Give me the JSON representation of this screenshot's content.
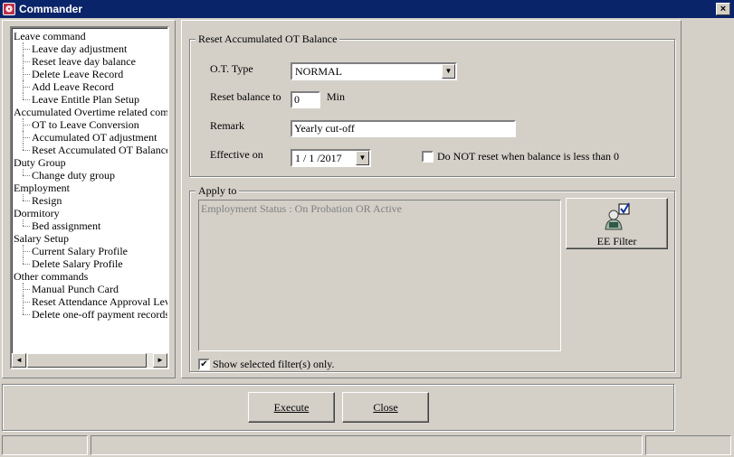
{
  "window": {
    "title": "Commander",
    "close_glyph": "×",
    "icon": "app-icon"
  },
  "tree": {
    "items": [
      {
        "label": "Leave command",
        "level": 0
      },
      {
        "label": "Leave day adjustment",
        "level": 1
      },
      {
        "label": "Reset leave day balance",
        "level": 1
      },
      {
        "label": "Delete Leave Record",
        "level": 1
      },
      {
        "label": "Add Leave Record",
        "level": 1
      },
      {
        "label": "Leave Entitle Plan Setup",
        "level": 1
      },
      {
        "label": "Accumulated Overtime related comm",
        "level": 0
      },
      {
        "label": "OT to Leave Conversion",
        "level": 1
      },
      {
        "label": "Accumulated OT adjustment",
        "level": 1
      },
      {
        "label": "Reset Accumulated OT Balance",
        "level": 1
      },
      {
        "label": "Duty Group",
        "level": 0
      },
      {
        "label": "Change duty group",
        "level": 1
      },
      {
        "label": "Employment",
        "level": 0
      },
      {
        "label": "Resign",
        "level": 1
      },
      {
        "label": "Dormitory",
        "level": 0
      },
      {
        "label": "Bed assignment",
        "level": 1
      },
      {
        "label": "Salary Setup",
        "level": 0
      },
      {
        "label": "Current Salary Profile",
        "level": 1
      },
      {
        "label": "Delete Salary Profile",
        "level": 1
      },
      {
        "label": "Other commands",
        "level": 0
      },
      {
        "label": "Manual Punch Card",
        "level": 1
      },
      {
        "label": "Reset Attendance Approval Leve",
        "level": 1
      },
      {
        "label": "Delete one-off payment records",
        "level": 1
      }
    ],
    "scroll_left": "◄",
    "scroll_right": "►"
  },
  "reset_group": {
    "title": "Reset Accumulated OT Balance",
    "ot_type_label": "O.T. Type",
    "ot_type_value": "NORMAL",
    "reset_balance_label": "Reset balance to",
    "reset_balance_value": "0",
    "unit": "Min",
    "remark_label": "Remark",
    "remark_value": "Yearly cut-off",
    "effective_label": "Effective on",
    "effective_value": "1 / 1 /2017",
    "no_reset_label": "Do NOT reset when balance is less than 0",
    "no_reset_checked": false,
    "drop_glyph": "▼"
  },
  "apply_group": {
    "title": "Apply to",
    "filter_text": "Employment Status : On Probation OR Active",
    "ee_filter_label": "EE Filter",
    "show_selected_label": "Show selected filter(s) only.",
    "show_selected_checked": true,
    "check_glyph": "✔"
  },
  "actions": {
    "execute_label": "Execute",
    "close_label": "Close"
  }
}
